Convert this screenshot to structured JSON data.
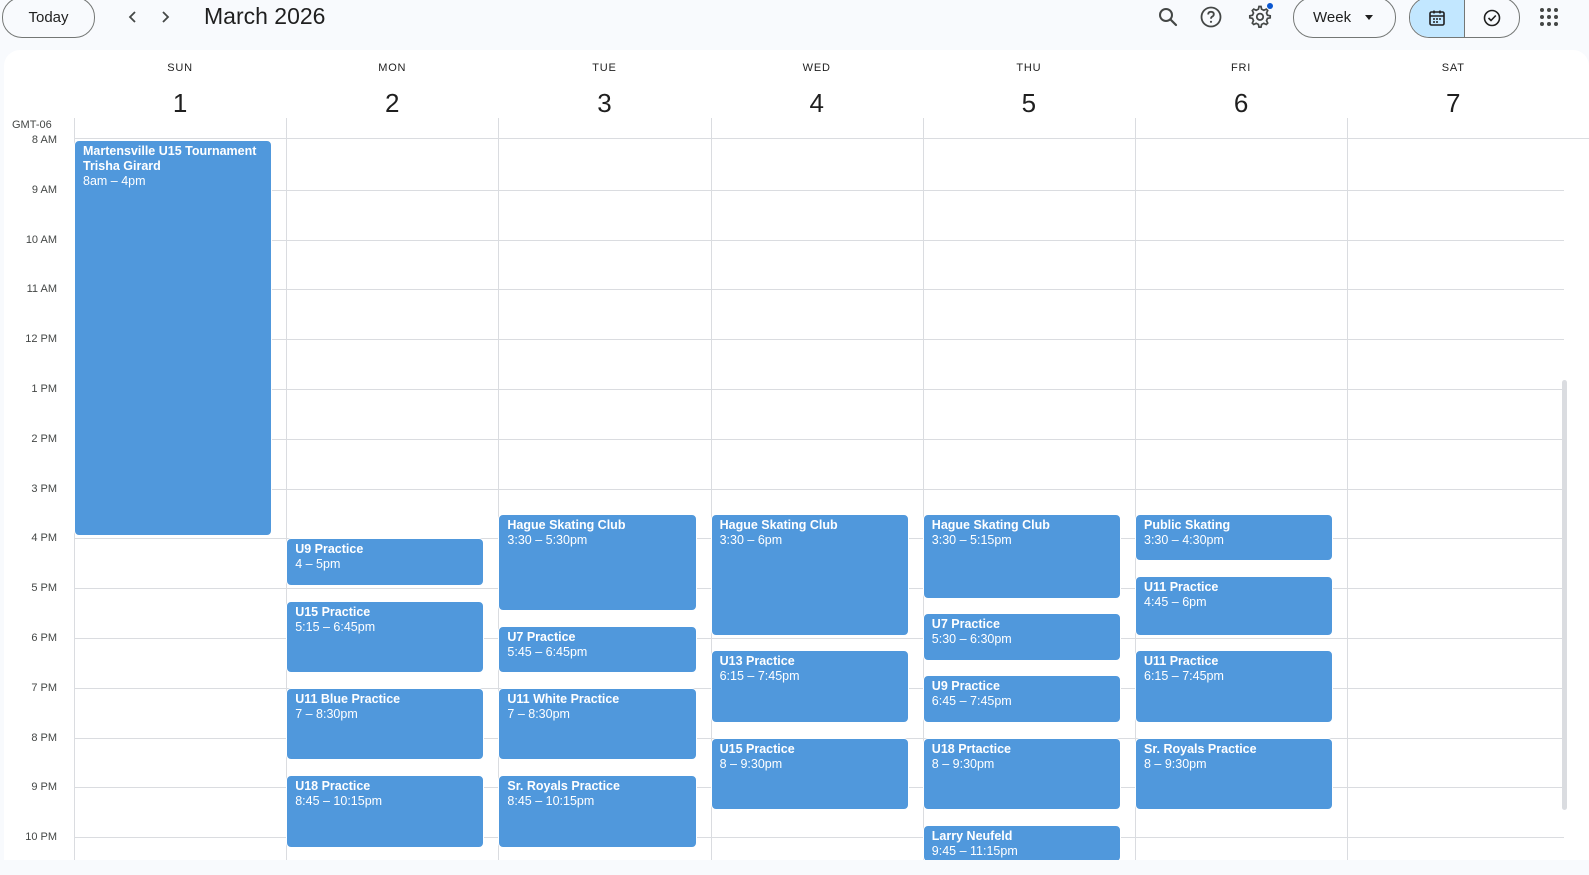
{
  "toolbar": {
    "today_label": "Today",
    "month_title": "March 2026",
    "view_label": "Week",
    "notification_dot_color": "#0b57d0",
    "active_toggle": "calendar"
  },
  "icons": {
    "prev": "chevron-left-icon",
    "next": "chevron-right-icon",
    "search": "search-icon",
    "help": "help-icon",
    "settings": "gear-icon",
    "calendar": "calendar-icon",
    "tasks": "check-circle-icon",
    "apps": "apps-grid-icon"
  },
  "calendar": {
    "timezone": "GMT-06",
    "event_color": "#5098dc",
    "days": [
      {
        "dow": "SUN",
        "num": "1"
      },
      {
        "dow": "MON",
        "num": "2"
      },
      {
        "dow": "TUE",
        "num": "3"
      },
      {
        "dow": "WED",
        "num": "4"
      },
      {
        "dow": "THU",
        "num": "5"
      },
      {
        "dow": "FRI",
        "num": "6"
      },
      {
        "dow": "SAT",
        "num": "7"
      }
    ],
    "hours": [
      "8 AM",
      "9 AM",
      "10 AM",
      "11 AM",
      "12 PM",
      "1 PM",
      "2 PM",
      "3 PM",
      "4 PM",
      "5 PM",
      "6 PM",
      "7 PM",
      "8 PM",
      "9 PM",
      "10 PM"
    ],
    "events": [
      {
        "day": 0,
        "start": 8.0,
        "end": 16.0,
        "title": "Martensville U15 Tournament",
        "subtitle": "Trisha Girard",
        "time": "8am – 4pm"
      },
      {
        "day": 1,
        "start": 16.0,
        "end": 17.0,
        "title": "U9 Practice",
        "time": "4 – 5pm"
      },
      {
        "day": 1,
        "start": 17.25,
        "end": 18.75,
        "title": "U15 Practice",
        "time": "5:15 – 6:45pm"
      },
      {
        "day": 1,
        "start": 19.0,
        "end": 20.5,
        "title": "U11 Blue Practice",
        "time": "7 – 8:30pm"
      },
      {
        "day": 1,
        "start": 20.75,
        "end": 22.25,
        "title": "U18 Practice",
        "time": "8:45 – 10:15pm"
      },
      {
        "day": 2,
        "start": 15.5,
        "end": 17.5,
        "title": "Hague Skating Club",
        "time": "3:30 – 5:30pm"
      },
      {
        "day": 2,
        "start": 17.75,
        "end": 18.75,
        "title": "U7 Practice",
        "time": "5:45 – 6:45pm"
      },
      {
        "day": 2,
        "start": 19.0,
        "end": 20.5,
        "title": "U11 White Practice",
        "time": "7 – 8:30pm"
      },
      {
        "day": 2,
        "start": 20.75,
        "end": 22.25,
        "title": "Sr. Royals Practice",
        "time": "8:45 – 10:15pm"
      },
      {
        "day": 3,
        "start": 15.5,
        "end": 18.0,
        "title": "Hague Skating Club",
        "time": "3:30 – 6pm"
      },
      {
        "day": 3,
        "start": 18.25,
        "end": 19.75,
        "title": "U13 Practice",
        "time": "6:15 – 7:45pm"
      },
      {
        "day": 3,
        "start": 20.0,
        "end": 21.5,
        "title": "U15 Practice",
        "time": "8 – 9:30pm"
      },
      {
        "day": 4,
        "start": 15.5,
        "end": 17.25,
        "title": "Hague Skating Club",
        "time": "3:30 – 5:15pm"
      },
      {
        "day": 4,
        "start": 17.5,
        "end": 18.5,
        "title": "U7 Practice",
        "time": "5:30 – 6:30pm"
      },
      {
        "day": 4,
        "start": 18.75,
        "end": 19.75,
        "title": "U9 Practice",
        "time": "6:45 – 7:45pm"
      },
      {
        "day": 4,
        "start": 20.0,
        "end": 21.5,
        "title": "U18 Prtactice",
        "time": "8 – 9:30pm"
      },
      {
        "day": 4,
        "start": 21.75,
        "end": 23.25,
        "title": "Larry Neufeld",
        "time": "9:45 – 11:15pm"
      },
      {
        "day": 5,
        "start": 15.5,
        "end": 16.5,
        "title": "Public Skating",
        "time": "3:30 – 4:30pm"
      },
      {
        "day": 5,
        "start": 16.75,
        "end": 18.0,
        "title": "U11 Practice",
        "time": "4:45 – 6pm"
      },
      {
        "day": 5,
        "start": 18.25,
        "end": 19.75,
        "title": "U11 Practice",
        "time": "6:15 – 7:45pm"
      },
      {
        "day": 5,
        "start": 20.0,
        "end": 21.5,
        "title": "Sr. Royals Practice",
        "time": "8 – 9:30pm"
      }
    ]
  }
}
